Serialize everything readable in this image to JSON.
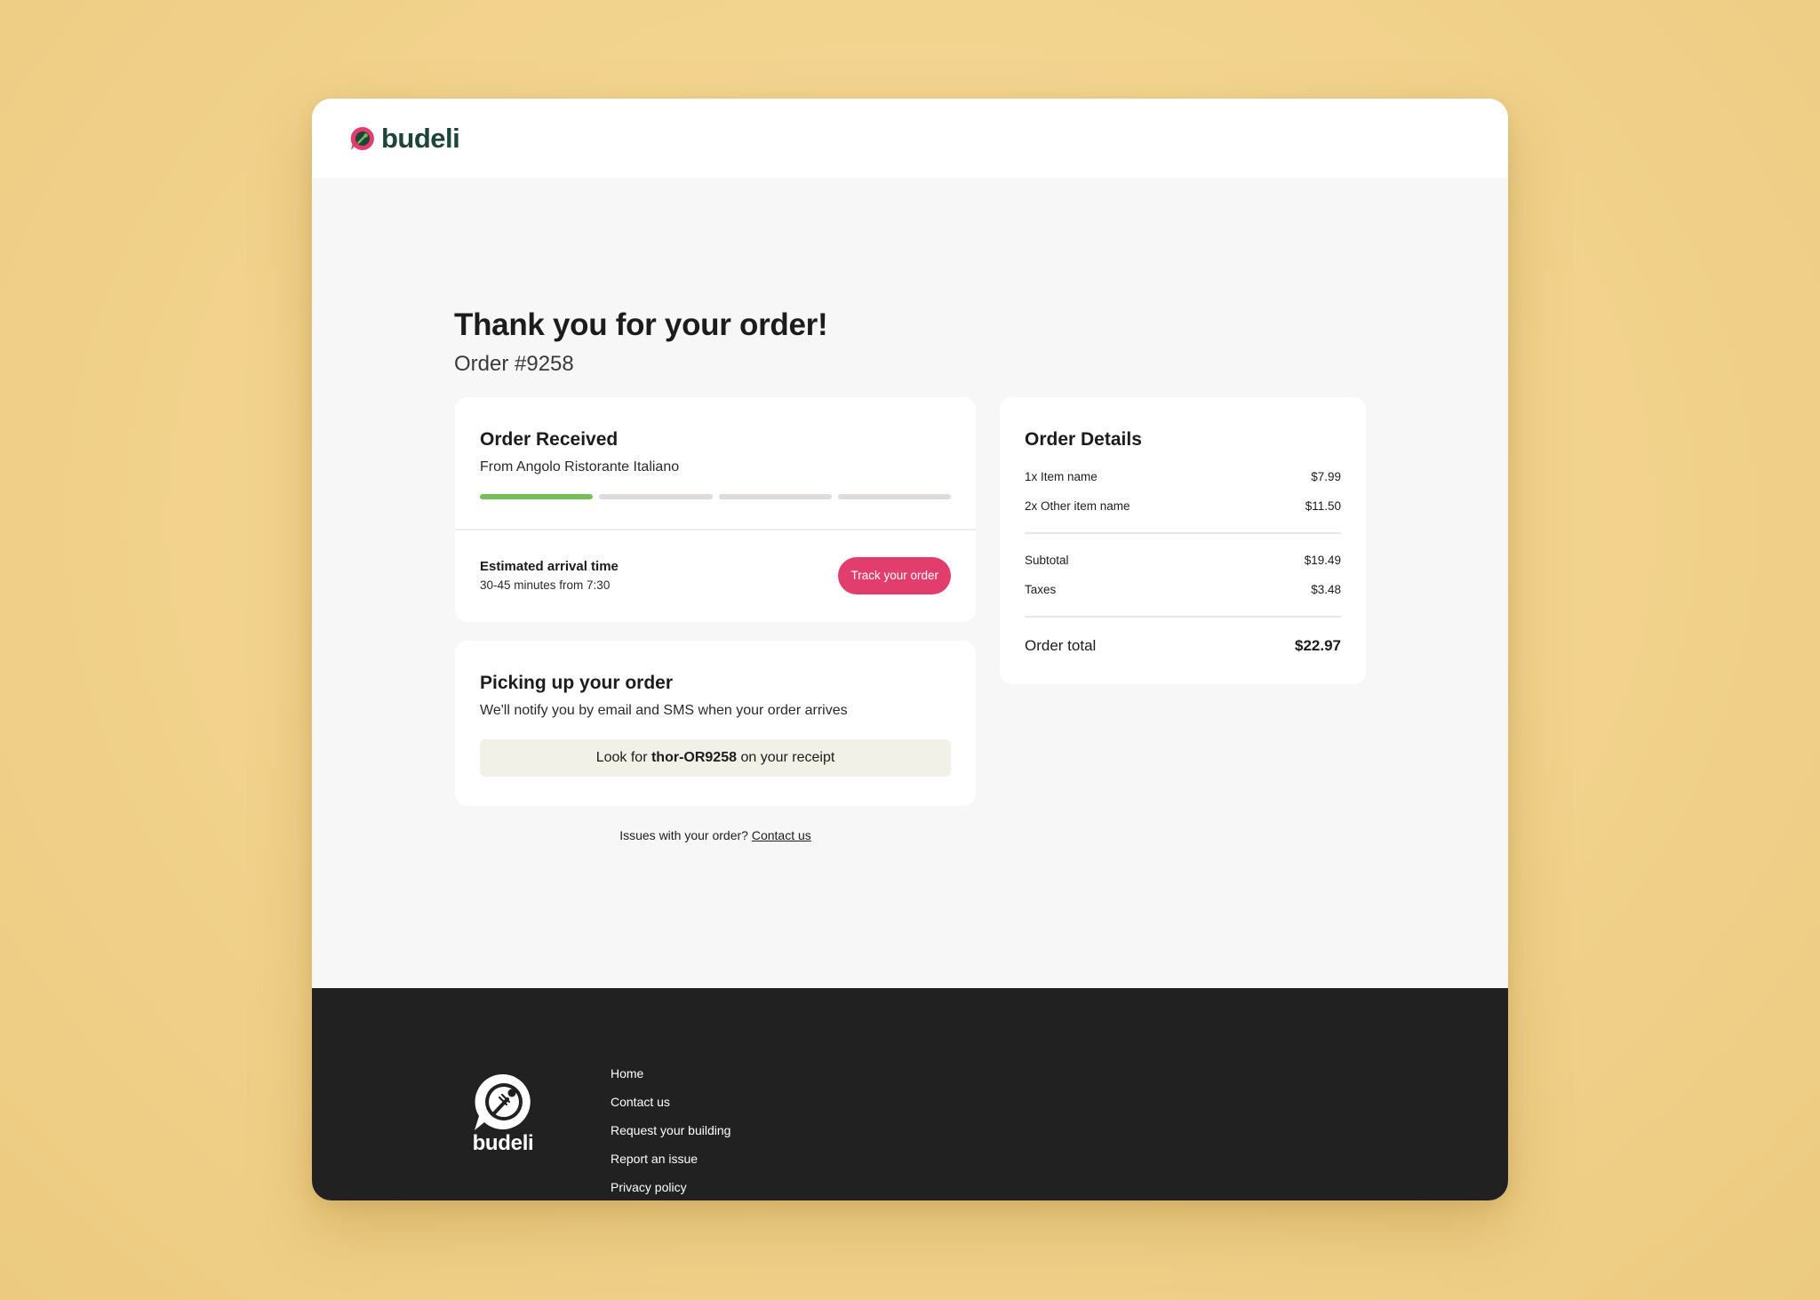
{
  "brand": {
    "name": "budeli"
  },
  "colors": {
    "accent": "#e23e6d",
    "progress_done": "#77bd5a",
    "progress_pending": "#e0dada",
    "brand_text": "#1d4439",
    "footer_bg": "#222122"
  },
  "header": {
    "title": "Thank you for your order!",
    "order_number": "Order #9258"
  },
  "status_card": {
    "title": "Order Received",
    "restaurant": "From Angolo Ristorante Italiano",
    "progress": {
      "completed_steps": 1,
      "total_steps": 4
    },
    "eta_label": "Estimated arrival time",
    "eta_value": "30-45 minutes from 7:30",
    "track_button": "Track your order"
  },
  "pickup_card": {
    "title": "Picking up your order",
    "subtitle": "We'll notify you by email and SMS when your order arrives",
    "receipt_prefix": "Look for ",
    "receipt_code": "thor-OR9258",
    "receipt_suffix": " on your receipt"
  },
  "issues": {
    "text": "Issues with your order? ",
    "link": "Contact us"
  },
  "details": {
    "title": "Order Details",
    "items": [
      {
        "name": "1x Item name",
        "price": "$7.99"
      },
      {
        "name": "2x Other item name",
        "price": "$11.50"
      }
    ],
    "subtotal_label": "Subtotal",
    "subtotal": "$19.49",
    "taxes_label": "Taxes",
    "taxes": "$3.48",
    "total_label": "Order total",
    "total": "$22.97"
  },
  "footer": {
    "links": [
      "Home",
      "Contact us",
      "Request your building",
      "Report an issue",
      "Privacy policy"
    ]
  }
}
